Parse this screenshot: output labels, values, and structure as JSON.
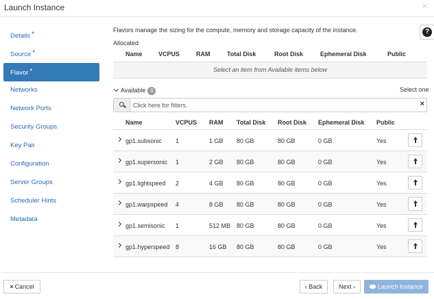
{
  "window": {
    "title": "Launch Instance",
    "close_glyph": "×"
  },
  "sidebar": {
    "items": [
      {
        "label": "Details",
        "required": true
      },
      {
        "label": "Source",
        "required": true
      },
      {
        "label": "Flavor",
        "required": true,
        "active": true
      },
      {
        "label": "Networks"
      },
      {
        "label": "Network Ports"
      },
      {
        "label": "Security Groups"
      },
      {
        "label": "Key Pair"
      },
      {
        "label": "Configuration"
      },
      {
        "label": "Server Groups"
      },
      {
        "label": "Scheduler Hints"
      },
      {
        "label": "Metadata"
      }
    ],
    "required_marker": "*"
  },
  "help_icon": "question-circle-icon",
  "main": {
    "description": "Flavors manage the sizing for the compute, memory and storage capacity of the instance.",
    "allocated_label": "Allocated",
    "columns": [
      "Name",
      "VCPUS",
      "RAM",
      "Total Disk",
      "Root Disk",
      "Ephemeral Disk",
      "Public"
    ],
    "allocated_empty": "Select an item from Available items below",
    "available_label": "Available",
    "available_count": "6",
    "select_hint": "Select one",
    "filter_placeholder": "Click here for filters.",
    "rows": [
      {
        "name": "gp1.subsonic",
        "vcpus": "1",
        "ram": "1 GB",
        "total_disk": "80 GB",
        "root_disk": "80 GB",
        "ephemeral_disk": "0 GB",
        "public": "Yes"
      },
      {
        "name": "gp1.supersonic",
        "vcpus": "1",
        "ram": "2 GB",
        "total_disk": "80 GB",
        "root_disk": "80 GB",
        "ephemeral_disk": "0 GB",
        "public": "Yes"
      },
      {
        "name": "gp1.lightspeed",
        "vcpus": "2",
        "ram": "4 GB",
        "total_disk": "80 GB",
        "root_disk": "80 GB",
        "ephemeral_disk": "0 GB",
        "public": "Yes"
      },
      {
        "name": "gp1.warpspeed",
        "vcpus": "4",
        "ram": "8 GB",
        "total_disk": "80 GB",
        "root_disk": "80 GB",
        "ephemeral_disk": "0 GB",
        "public": "Yes"
      },
      {
        "name": "gp1.semisonic",
        "vcpus": "1",
        "ram": "512 MB",
        "total_disk": "80 GB",
        "root_disk": "80 GB",
        "ephemeral_disk": "0 GB",
        "public": "Yes"
      },
      {
        "name": "gp1.hyperspeed",
        "vcpus": "8",
        "ram": "16 GB",
        "total_disk": "80 GB",
        "root_disk": "80 GB",
        "ephemeral_disk": "0 GB",
        "public": "Yes"
      }
    ]
  },
  "footer": {
    "cancel_label": "Cancel",
    "back_label": "Back",
    "next_label": "Next",
    "launch_label": "Launch Instance"
  },
  "colors": {
    "accent": "#337ab7",
    "launch_disabled": "#8eb4db",
    "link": "#2a6ab0"
  }
}
